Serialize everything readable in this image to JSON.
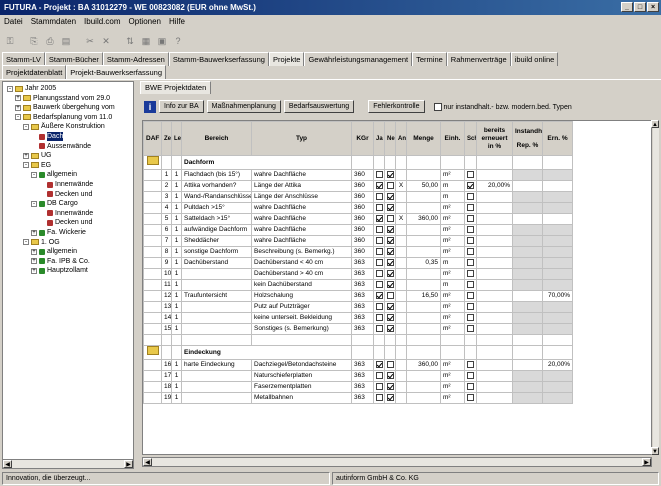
{
  "window": {
    "title": "FUTURA - Projekt : BA 31012279 - WE 00823082 (EUR ohne MwSt.)"
  },
  "menu": [
    "Datei",
    "Stammdaten",
    "Ibuild.com",
    "Optionen",
    "Hilfe"
  ],
  "toolbar_icons": [
    "lock-icon",
    "copy-icon",
    "print-icon",
    "preview-icon",
    "cut-icon",
    "delete-icon",
    "sort-icon",
    "calculator-icon",
    "save-icon",
    "help-icon"
  ],
  "tabs_main": [
    "Stamm-LV",
    "Stamm-Bücher",
    "Stamm-Adressen",
    "Stamm-Bauwerkserfassung",
    "Projekte",
    "Gewährleistungsmanagement",
    "Termine",
    "Rahmenverträge",
    "ibuild online"
  ],
  "tabs_main_active": 4,
  "tabs_sub": [
    "Projektdatenblatt",
    "Projekt-Bauwerkserfassung"
  ],
  "tabs_sub_active": 1,
  "tree": [
    {
      "label": "Jahr 2005",
      "level": 0,
      "pm": "-",
      "kind": "folder"
    },
    {
      "label": "Planungsstand vom 29.0",
      "level": 1,
      "pm": "+",
      "kind": "folder"
    },
    {
      "label": "Bauwerk übergehung vom",
      "level": 1,
      "pm": "+",
      "kind": "folder"
    },
    {
      "label": "Bedarfsplanung vom 11.0",
      "level": 1,
      "pm": "-",
      "kind": "folder"
    },
    {
      "label": "Äußere Konstruktion",
      "level": 2,
      "pm": "-",
      "kind": "folder"
    },
    {
      "label": "Dach",
      "level": 3,
      "pm": "",
      "kind": "leaf",
      "selected": true
    },
    {
      "label": "Aussenwände",
      "level": 3,
      "pm": "",
      "kind": "leaf"
    },
    {
      "label": "UG",
      "level": 2,
      "pm": "+",
      "kind": "folder"
    },
    {
      "label": "EG",
      "level": 2,
      "pm": "-",
      "kind": "folder"
    },
    {
      "label": "allgemein",
      "level": 3,
      "pm": "-",
      "kind": "green"
    },
    {
      "label": "Innenwände",
      "level": 4,
      "pm": "",
      "kind": "leaf"
    },
    {
      "label": "Decken und",
      "level": 4,
      "pm": "",
      "kind": "leaf"
    },
    {
      "label": "DB Cargo",
      "level": 3,
      "pm": "-",
      "kind": "green"
    },
    {
      "label": "Innenwände",
      "level": 4,
      "pm": "",
      "kind": "leaf"
    },
    {
      "label": "Decken und",
      "level": 4,
      "pm": "",
      "kind": "leaf"
    },
    {
      "label": "Fa. Wickerie",
      "level": 3,
      "pm": "+",
      "kind": "green"
    },
    {
      "label": "1. OG",
      "level": 2,
      "pm": "-",
      "kind": "folder"
    },
    {
      "label": "allgemein",
      "level": 3,
      "pm": "+",
      "kind": "green"
    },
    {
      "label": "Fa. IPB & Co.",
      "level": 3,
      "pm": "+",
      "kind": "green"
    },
    {
      "label": "Hauptzollamt",
      "level": 3,
      "pm": "+",
      "kind": "green"
    }
  ],
  "panel_tab": "BWE Projektdaten",
  "buttons": [
    "Info zur BA",
    "Maßnahmenplanung",
    "Bedarfsauswertung",
    "Fehlerkontrolle"
  ],
  "filter_label": "nur instandhalt.- bzw. modern.bed. Typen",
  "columns": [
    "DAF",
    "Zeile",
    "Level",
    "Bereich",
    "Typ",
    "KGr",
    "Ja",
    "Nein",
    "Anlage",
    "Menge",
    "Einh.",
    "Schadt.",
    "bereits erneuert in %",
    "Rep. %",
    "Ern. %"
  ],
  "col_group": "Instandhalt.",
  "sections": [
    {
      "title": "Dachform",
      "rows": [
        {
          "zeile": "1",
          "level": "1",
          "bereich": "Flachdach (bis 15°)",
          "typ": "wahre Dachfläche",
          "kgr": "360",
          "ja": false,
          "nein": true,
          "anlage": "",
          "menge": "",
          "einh": "m²",
          "schadt": false,
          "bereits": "",
          "rep": "",
          "ern": ""
        },
        {
          "zeile": "2",
          "level": "1",
          "bereich": "Attika vorhanden?",
          "typ": "Länge der Attika",
          "kgr": "360",
          "ja": true,
          "nein": false,
          "anlage": "X",
          "menge": "50,00",
          "einh": "m",
          "schadt": true,
          "bereits": "20,00%",
          "rep": "",
          "ern": ""
        },
        {
          "zeile": "3",
          "level": "1",
          "bereich": "Wand-/Randanschlüsse",
          "typ": "Länge der Anschlüsse",
          "kgr": "360",
          "ja": false,
          "nein": true,
          "anlage": "",
          "menge": "",
          "einh": "m",
          "schadt": false,
          "bereits": "",
          "rep": "",
          "ern": ""
        },
        {
          "zeile": "4",
          "level": "1",
          "bereich": "Pultdach >15°",
          "typ": "wahre Dachfläche",
          "kgr": "360",
          "ja": false,
          "nein": true,
          "anlage": "",
          "menge": "",
          "einh": "m²",
          "schadt": false,
          "bereits": "",
          "rep": "",
          "ern": ""
        },
        {
          "zeile": "5",
          "level": "1",
          "bereich": "Satteldach >15°",
          "typ": "wahre Dachfläche",
          "kgr": "360",
          "ja": true,
          "nein": false,
          "anlage": "X",
          "menge": "360,00",
          "einh": "m²",
          "schadt": false,
          "bereits": "",
          "rep": "",
          "ern": ""
        },
        {
          "zeile": "6",
          "level": "1",
          "bereich": "aufwändige Dachform",
          "typ": "wahre Dachfläche",
          "kgr": "360",
          "ja": false,
          "nein": true,
          "anlage": "",
          "menge": "",
          "einh": "m²",
          "schadt": false,
          "bereits": "",
          "rep": "",
          "ern": ""
        },
        {
          "zeile": "7",
          "level": "1",
          "bereich": "Sheddächer",
          "typ": "wahre Dachfläche",
          "kgr": "360",
          "ja": false,
          "nein": true,
          "anlage": "",
          "menge": "",
          "einh": "m²",
          "schadt": false,
          "bereits": "",
          "rep": "",
          "ern": ""
        },
        {
          "zeile": "8",
          "level": "1",
          "bereich": "sonstige Dachform",
          "typ": "Beschreibung (s. Bemerkg.)",
          "kgr": "360",
          "ja": false,
          "nein": true,
          "anlage": "",
          "menge": "",
          "einh": "m²",
          "schadt": false,
          "bereits": "",
          "rep": "",
          "ern": ""
        },
        {
          "zeile": "9",
          "level": "1",
          "bereich": "Dachüberstand",
          "typ": "Dachüberstand < 40 cm",
          "kgr": "363",
          "ja": false,
          "nein": true,
          "anlage": "",
          "menge": "0,35",
          "einh": "m",
          "schadt": false,
          "bereits": "",
          "rep": "",
          "ern": ""
        },
        {
          "zeile": "10",
          "level": "1",
          "bereich": "",
          "typ": "Dachüberstand > 40 cm",
          "kgr": "363",
          "ja": false,
          "nein": true,
          "anlage": "",
          "menge": "",
          "einh": "m²",
          "schadt": false,
          "bereits": "",
          "rep": "",
          "ern": ""
        },
        {
          "zeile": "11",
          "level": "1",
          "bereich": "",
          "typ": "kein Dachüberstand",
          "kgr": "363",
          "ja": false,
          "nein": true,
          "anlage": "",
          "menge": "",
          "einh": "m",
          "schadt": false,
          "bereits": "",
          "rep": "",
          "ern": ""
        },
        {
          "zeile": "12",
          "level": "1",
          "bereich": "Traufuntersicht",
          "typ": "Holzschalung",
          "kgr": "363",
          "ja": true,
          "nein": false,
          "anlage": "",
          "menge": "16,50",
          "einh": "m²",
          "schadt": false,
          "bereits": "",
          "rep": "",
          "ern": "70,00%"
        },
        {
          "zeile": "13",
          "level": "1",
          "bereich": "",
          "typ": "Putz auf Putzträger",
          "kgr": "363",
          "ja": false,
          "nein": true,
          "anlage": "",
          "menge": "",
          "einh": "m²",
          "schadt": false,
          "bereits": "",
          "rep": "",
          "ern": ""
        },
        {
          "zeile": "14",
          "level": "1",
          "bereich": "",
          "typ": "keine unterseit. Bekleidung",
          "kgr": "363",
          "ja": false,
          "nein": true,
          "anlage": "",
          "menge": "",
          "einh": "m²",
          "schadt": false,
          "bereits": "",
          "rep": "",
          "ern": ""
        },
        {
          "zeile": "15",
          "level": "1",
          "bereich": "",
          "typ": "Sonstiges (s. Bemerkung)",
          "kgr": "363",
          "ja": false,
          "nein": true,
          "anlage": "",
          "menge": "",
          "einh": "m²",
          "schadt": false,
          "bereits": "",
          "rep": "",
          "ern": ""
        }
      ]
    },
    {
      "title": "Eindeckung",
      "rows": [
        {
          "zeile": "16",
          "level": "1",
          "bereich": "harte Eindeckung",
          "typ": "Dachziegel/Betondachsteine",
          "kgr": "363",
          "ja": true,
          "nein": false,
          "anlage": "",
          "menge": "360,00",
          "einh": "m²",
          "schadt": false,
          "bereits": "",
          "rep": "",
          "ern": "20,00%"
        },
        {
          "zeile": "17",
          "level": "1",
          "bereich": "",
          "typ": "Naturschieferplatten",
          "kgr": "363",
          "ja": false,
          "nein": true,
          "anlage": "",
          "menge": "",
          "einh": "m²",
          "schadt": false,
          "bereits": "",
          "rep": "",
          "ern": ""
        },
        {
          "zeile": "18",
          "level": "1",
          "bereich": "",
          "typ": "Faserzementplatten",
          "kgr": "363",
          "ja": false,
          "nein": true,
          "anlage": "",
          "menge": "",
          "einh": "m²",
          "schadt": false,
          "bereits": "",
          "rep": "",
          "ern": ""
        },
        {
          "zeile": "19",
          "level": "1",
          "bereich": "",
          "typ": "Metallbahnen",
          "kgr": "363",
          "ja": false,
          "nein": true,
          "anlage": "",
          "menge": "",
          "einh": "m²",
          "schadt": false,
          "bereits": "",
          "rep": "",
          "ern": ""
        }
      ]
    }
  ],
  "status": {
    "left": "Innovation, die überzeugt...",
    "right": "autinform GmbH & Co. KG"
  }
}
